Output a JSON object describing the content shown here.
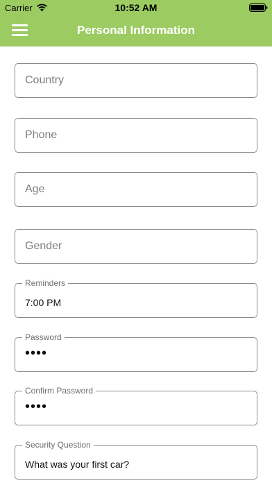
{
  "status_bar": {
    "carrier": "Carrier",
    "time": "10:52 AM",
    "wifi_icon": "wifi-icon",
    "battery_icon": "battery-icon"
  },
  "nav": {
    "title": "Personal Information",
    "menu_icon": "hamburger-menu-icon",
    "color": "#9ccb62"
  },
  "form": {
    "country": {
      "placeholder": "Country"
    },
    "phone": {
      "placeholder": "Phone"
    },
    "age": {
      "placeholder": "Age"
    },
    "gender": {
      "placeholder": "Gender"
    },
    "reminders": {
      "label": "Reminders",
      "value": "7:00 PM"
    },
    "password": {
      "label": "Password",
      "value": "••••"
    },
    "confirm_password": {
      "label": "Confirm Password",
      "value": "••••"
    },
    "security_question": {
      "label": "Security Question",
      "value": "What was your first car?"
    }
  }
}
